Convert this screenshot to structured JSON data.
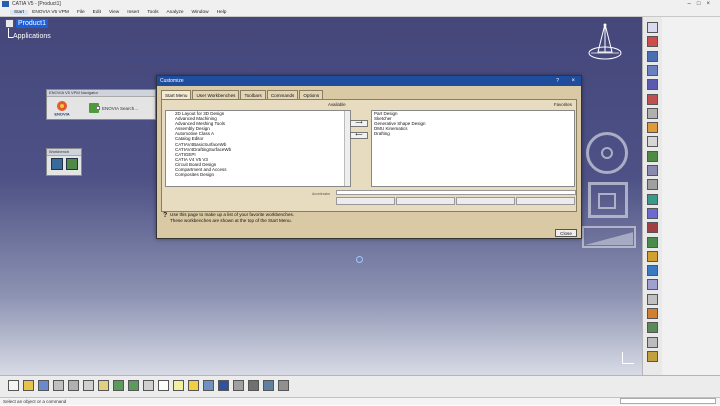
{
  "window": {
    "title": "CATIA V5 - [Product1]"
  },
  "menubar": {
    "items": [
      "Start",
      "ENOVIA V5 VPM",
      "File",
      "Edit",
      "View",
      "Insert",
      "Tools",
      "Analyze",
      "Window",
      "Help"
    ]
  },
  "tree": {
    "root": "Product1",
    "child": "Applications"
  },
  "nav_toolbar": {
    "title": "ENOVIA V5 VPM Navigator",
    "search_label": "ENOVIA Search...",
    "logo_text": "ENOVIA"
  },
  "workbench_toolbar": {
    "title": "Workbench"
  },
  "dialog": {
    "title": "Customize",
    "help": "?",
    "close": "×",
    "tabs": [
      "Start Menu",
      "User Workbenches",
      "Toolbars",
      "Commands",
      "Options"
    ],
    "active_tab": 0,
    "available_label": "Available",
    "favorites_label": "Favorites",
    "available": [
      "2D Layout for 3D Design",
      "Advanced Machining",
      "Advanced Meshing Tools",
      "Assembly Design",
      "Automotive Class A",
      "Catalog Editor",
      "CATIAV4BasicSurfaceWb",
      "CATIAV4DraftingSurfaceWb",
      "CATIGEPI",
      "CATIA V4 V5 V3",
      "Circuit Board Design",
      "Compartment and Access",
      "Composites Design"
    ],
    "favorites": [
      "Part Design",
      "Sketcher",
      "Generative Shape Design",
      "DMU Kinematics",
      "Drafting"
    ],
    "add_arrow": "⟶",
    "remove_arrow": "⟵",
    "accelerator_label": "Accelerator",
    "hint_line1": "Use this page to make up a list of your favorite workbenches.",
    "hint_line2": "These workbenches are shown at the top of the Start Menu.",
    "close_button": "Close"
  },
  "status": {
    "text": "Select an object or a command"
  },
  "icons": {
    "right": [
      "sketcher-icon",
      "plane-icon",
      "product-icon",
      "component-icon",
      "part-icon",
      "existing-component-icon",
      "replace-icon",
      "graph-tree-icon",
      "reorder-icon",
      "constraint-icon",
      "fix-icon",
      "coincidence-icon",
      "contact-icon",
      "offset-icon",
      "angle-icon",
      "fix-together-icon",
      "smart-move-icon",
      "explode-icon",
      "update-icon",
      "snap-icon",
      "manipulation-icon",
      "clash-icon",
      "section-icon",
      "measure-icon"
    ],
    "bottom": [
      "new-icon",
      "open-icon",
      "save-icon",
      "print-icon",
      "cut-icon",
      "copy-icon",
      "paste-icon",
      "undo-icon",
      "redo-icon",
      "whats-this-icon",
      "formula-icon",
      "comment-icon",
      "light-icon",
      "grid-icon",
      "compass-icon",
      "measure-icon",
      "tools-icon",
      "catalog-icon",
      "render-icon"
    ]
  }
}
